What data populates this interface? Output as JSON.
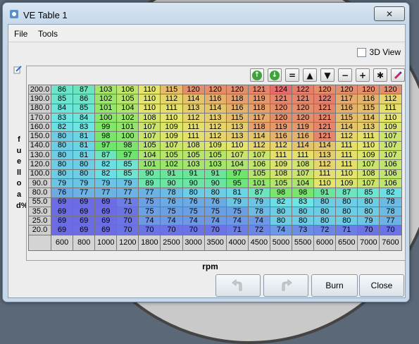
{
  "window": {
    "title": "VE Table 1",
    "close_glyph": "✕"
  },
  "menu": {
    "file": "File",
    "tools": "Tools"
  },
  "view3d_label": "3D View",
  "yaxis_label": "fuelload%",
  "xaxis_label": "rpm",
  "toolbar": {
    "equals": "=",
    "up": "▲",
    "down": "▼",
    "minus": "−",
    "plus": "+",
    "times": "✱"
  },
  "buttons": {
    "burn": "Burn",
    "close": "Close"
  },
  "table": {
    "rows": [
      "200.0",
      "190.0",
      "180.0",
      "170.0",
      "160.0",
      "150.0",
      "140.0",
      "130.0",
      "120.0",
      "100.0",
      "90.0",
      "80.0",
      "55.0",
      "35.0",
      "25.0",
      "20.0"
    ],
    "cols": [
      "600",
      "800",
      "1000",
      "1200",
      "1800",
      "2500",
      "3000",
      "3500",
      "4000",
      "4500",
      "5000",
      "5500",
      "6000",
      "6500",
      "7000",
      "7600"
    ],
    "values": [
      [
        "86",
        "87",
        "103",
        "106",
        "110",
        "115",
        "120",
        "120",
        "120",
        "121",
        "124",
        "122",
        "120",
        "120",
        "120",
        "120"
      ],
      [
        "85",
        "86",
        "102",
        "105",
        "110",
        "112",
        "114",
        "116",
        "118",
        "119",
        "121",
        "121",
        "122",
        "117",
        "116",
        "112"
      ],
      [
        "84",
        "85",
        "101",
        "104",
        "110",
        "111",
        "113",
        "114",
        "116",
        "118",
        "120",
        "120",
        "121",
        "116",
        "115",
        "111"
      ],
      [
        "83",
        "84",
        "100",
        "102",
        "108",
        "110",
        "112",
        "113",
        "115",
        "117",
        "120",
        "120",
        "121",
        "115",
        "114",
        "110"
      ],
      [
        "82",
        "83",
        "99",
        "101",
        "107",
        "109",
        "111",
        "112",
        "113",
        "118",
        "119",
        "119",
        "121",
        "114",
        "113",
        "109"
      ],
      [
        "80",
        "81",
        "98",
        "100",
        "107",
        "109",
        "111",
        "112",
        "113",
        "114",
        "116",
        "116",
        "121",
        "112",
        "111",
        "107"
      ],
      [
        "80",
        "81",
        "97",
        "98",
        "105",
        "107",
        "108",
        "109",
        "110",
        "112",
        "112",
        "114",
        "114",
        "111",
        "110",
        "107"
      ],
      [
        "80",
        "81",
        "87",
        "97",
        "104",
        "105",
        "105",
        "105",
        "107",
        "107",
        "111",
        "111",
        "113",
        "111",
        "109",
        "107"
      ],
      [
        "80",
        "80",
        "82",
        "85",
        "101",
        "102",
        "103",
        "103",
        "104",
        "106",
        "109",
        "108",
        "112",
        "111",
        "107",
        "106"
      ],
      [
        "80",
        "80",
        "82",
        "85",
        "90",
        "91",
        "91",
        "91",
        "97",
        "105",
        "108",
        "107",
        "111",
        "110",
        "108",
        "106"
      ],
      [
        "79",
        "79",
        "79",
        "79",
        "89",
        "90",
        "90",
        "90",
        "95",
        "101",
        "105",
        "104",
        "110",
        "109",
        "107",
        "106"
      ],
      [
        "76",
        "77",
        "77",
        "77",
        "77",
        "78",
        "80",
        "80",
        "81",
        "87",
        "98",
        "98",
        "91",
        "87",
        "85",
        "82"
      ],
      [
        "69",
        "69",
        "69",
        "71",
        "75",
        "76",
        "76",
        "76",
        "79",
        "79",
        "82",
        "83",
        "80",
        "80",
        "80",
        "78"
      ],
      [
        "69",
        "69",
        "69",
        "70",
        "75",
        "75",
        "75",
        "75",
        "75",
        "78",
        "80",
        "80",
        "80",
        "80",
        "80",
        "78"
      ],
      [
        "69",
        "69",
        "69",
        "70",
        "74",
        "74",
        "74",
        "74",
        "74",
        "74",
        "80",
        "80",
        "80",
        "80",
        "79",
        "77"
      ],
      [
        "69",
        "69",
        "69",
        "70",
        "70",
        "70",
        "70",
        "70",
        "71",
        "72",
        "74",
        "73",
        "72",
        "71",
        "70",
        "70"
      ]
    ]
  }
}
